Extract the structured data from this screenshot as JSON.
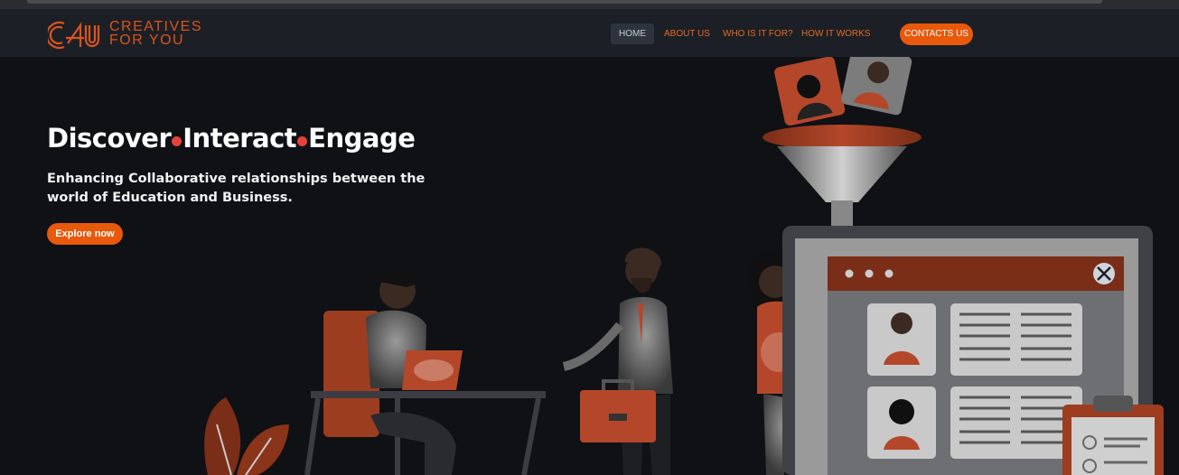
{
  "brand": {
    "line1": "CREATIVES",
    "line2": "FOR YOU",
    "color": "#d9531e"
  },
  "nav": {
    "home": "HOME",
    "about": "ABOUT US",
    "who": "WHO IS IT FOR?",
    "how": "HOW IT WORKS",
    "contact": "CONTACTS US"
  },
  "hero": {
    "title_words": [
      "Discover",
      "Interact",
      "Engage"
    ],
    "subtitle": "Enhancing Collaborative relationships between the world of Education and Business.",
    "cta": "Explore now"
  },
  "colors": {
    "accent": "#e8590c",
    "dot": "#e8403a",
    "background": "#0f1115",
    "navbar": "#1c2026"
  }
}
